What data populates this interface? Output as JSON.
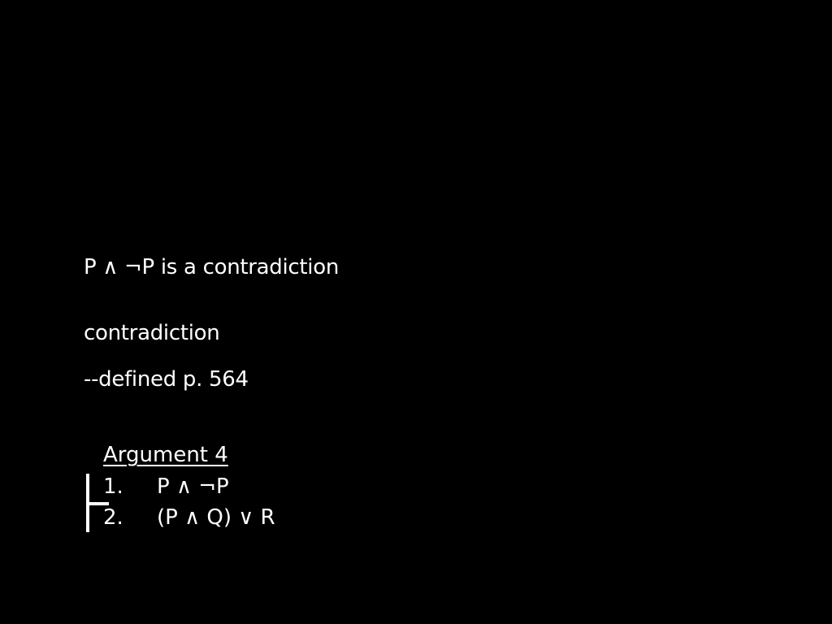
{
  "slide": {
    "lines": [
      "P ∧ ¬P is a contradiction",
      "contradiction",
      "--defined p. 564"
    ],
    "argument": {
      "title": "Argument 4",
      "steps": [
        {
          "number": "1.",
          "formula": "P ∧ ¬P"
        },
        {
          "number": "2.",
          "formula": "(P ∧ Q) ∨ R"
        }
      ]
    }
  }
}
